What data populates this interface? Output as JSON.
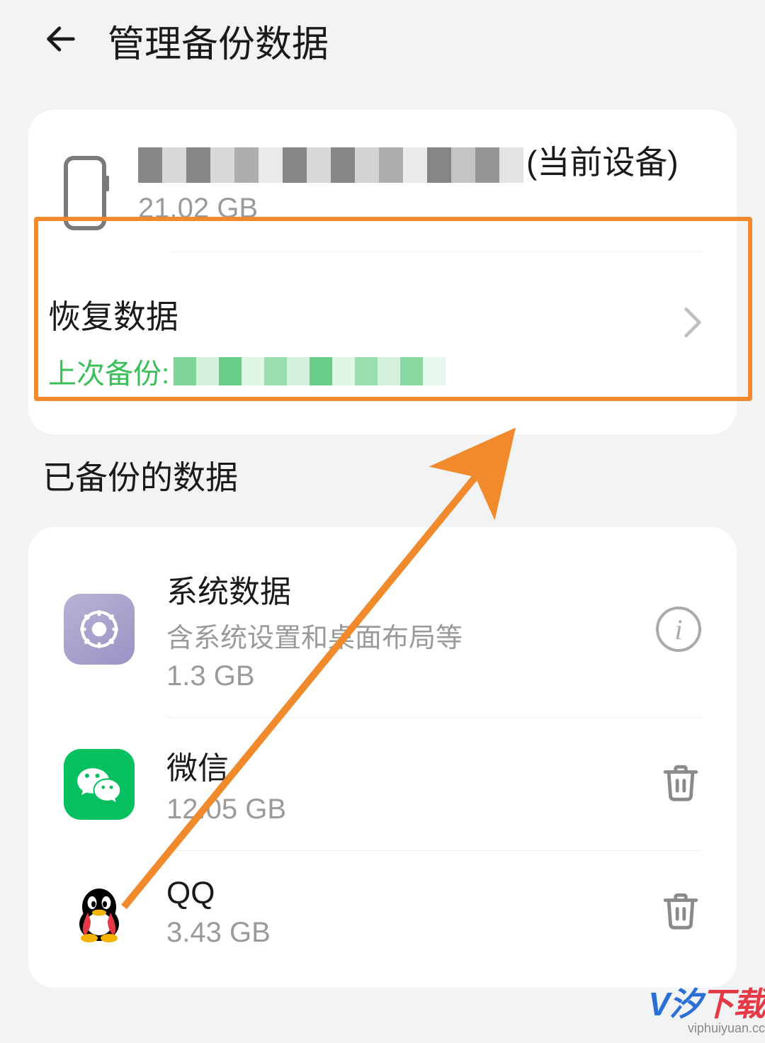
{
  "header": {
    "title": "管理备份数据"
  },
  "device": {
    "suffix": "(当前设备)",
    "size": "21.02 GB"
  },
  "restore": {
    "title": "恢复数据",
    "last_backup_label": "上次备份:"
  },
  "section_title": "已备份的数据",
  "items": [
    {
      "name": "系统数据",
      "desc": "含系统设置和桌面布局等",
      "size": "1.3 GB",
      "action": "info"
    },
    {
      "name": "微信",
      "desc": "",
      "size": "12.05 GB",
      "action": "trash"
    },
    {
      "name": "QQ",
      "desc": "",
      "size": "3.43 GB",
      "action": "trash"
    }
  ],
  "watermark": {
    "main_1": "V",
    "main_2": "汐",
    "main_3": "下载",
    "sub": "viphuiyuan.cc"
  }
}
